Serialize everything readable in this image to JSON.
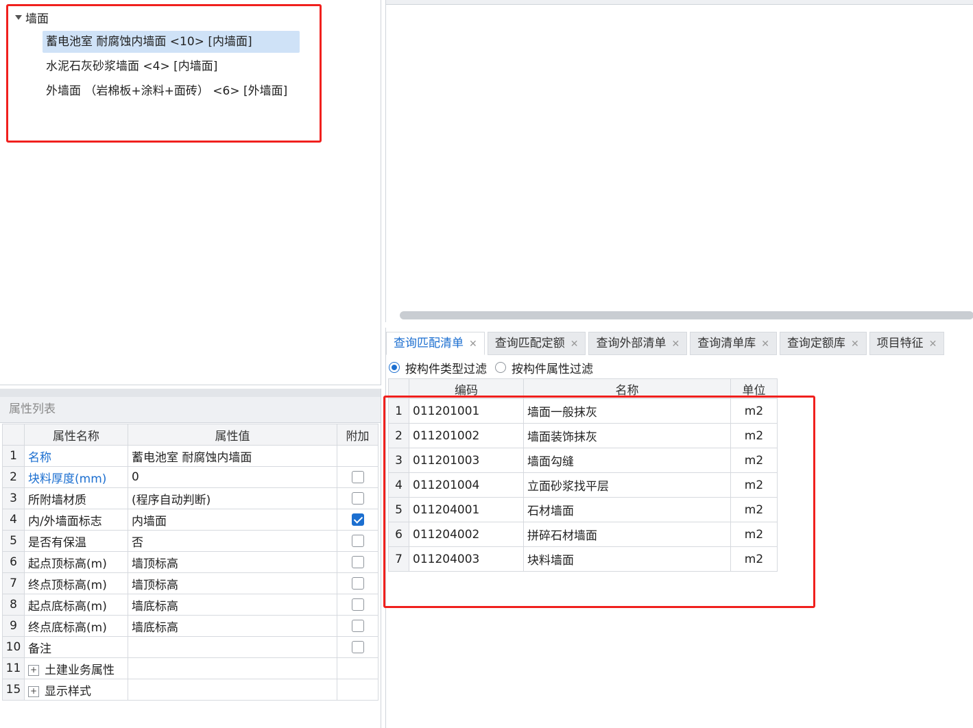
{
  "tree": {
    "root_label": "墙面",
    "items": [
      {
        "label": "蓄电池室 耐腐蚀内墙面 <10> [内墙面]",
        "selected": true
      },
      {
        "label": "水泥石灰砂浆墙面 <4> [内墙面]",
        "selected": false
      },
      {
        "label": "外墙面 （岩棉板+涂料+面砖） <6> [外墙面]",
        "selected": false
      }
    ]
  },
  "properties": {
    "title": "属性列表",
    "headers": {
      "name": "属性名称",
      "value": "属性值",
      "extra": "附加"
    },
    "rows": [
      {
        "num": "1",
        "name": "名称",
        "value": "蓄电池室 耐腐蚀内墙面",
        "link": true,
        "checkbox": "none"
      },
      {
        "num": "2",
        "name": "块料厚度(mm)",
        "value": "0",
        "link": true,
        "checkbox": "off"
      },
      {
        "num": "3",
        "name": "所附墙材质",
        "value": "(程序自动判断)",
        "link": false,
        "checkbox": "off"
      },
      {
        "num": "4",
        "name": "内/外墙面标志",
        "value": "内墙面",
        "link": false,
        "checkbox": "on"
      },
      {
        "num": "5",
        "name": "是否有保温",
        "value": "否",
        "link": false,
        "checkbox": "off"
      },
      {
        "num": "6",
        "name": "起点顶标高(m)",
        "value": "墙顶标高",
        "link": false,
        "checkbox": "off"
      },
      {
        "num": "7",
        "name": "终点顶标高(m)",
        "value": "墙顶标高",
        "link": false,
        "checkbox": "off"
      },
      {
        "num": "8",
        "name": "起点底标高(m)",
        "value": "墙底标高",
        "link": false,
        "checkbox": "off"
      },
      {
        "num": "9",
        "name": "终点底标高(m)",
        "value": "墙底标高",
        "link": false,
        "checkbox": "off"
      },
      {
        "num": "10",
        "name": "备注",
        "value": "",
        "link": false,
        "checkbox": "off"
      },
      {
        "num": "11",
        "name": "土建业务属性",
        "value": "",
        "link": false,
        "checkbox": "none",
        "expandable": true
      },
      {
        "num": "15",
        "name": "显示样式",
        "value": "",
        "link": false,
        "checkbox": "none",
        "expandable": true
      }
    ]
  },
  "tabs": [
    {
      "label": "查询匹配清单",
      "active": true
    },
    {
      "label": "查询匹配定额",
      "active": false
    },
    {
      "label": "查询外部清单",
      "active": false
    },
    {
      "label": "查询清单库",
      "active": false
    },
    {
      "label": "查询定额库",
      "active": false
    },
    {
      "label": "项目特征",
      "active": false
    }
  ],
  "filters": [
    {
      "label": "按构件类型过滤",
      "selected": true
    },
    {
      "label": "按构件属性过滤",
      "selected": false
    }
  ],
  "list": {
    "headers": {
      "code": "编码",
      "name": "名称",
      "unit": "单位"
    },
    "rows": [
      {
        "num": "1",
        "code": "011201001",
        "name": "墙面一般抹灰",
        "unit": "m2"
      },
      {
        "num": "2",
        "code": "011201002",
        "name": "墙面装饰抹灰",
        "unit": "m2"
      },
      {
        "num": "3",
        "code": "011201003",
        "name": "墙面勾缝",
        "unit": "m2"
      },
      {
        "num": "4",
        "code": "011201004",
        "name": "立面砂浆找平层",
        "unit": "m2"
      },
      {
        "num": "5",
        "code": "011204001",
        "name": "石材墙面",
        "unit": "m2"
      },
      {
        "num": "6",
        "code": "011204002",
        "name": "拼碎石材墙面",
        "unit": "m2"
      },
      {
        "num": "7",
        "code": "011204003",
        "name": "块料墙面",
        "unit": "m2"
      }
    ]
  },
  "colors": {
    "accent": "#1c6fd0",
    "highlight": "#f0201d",
    "selection": "#cfe2f7"
  }
}
